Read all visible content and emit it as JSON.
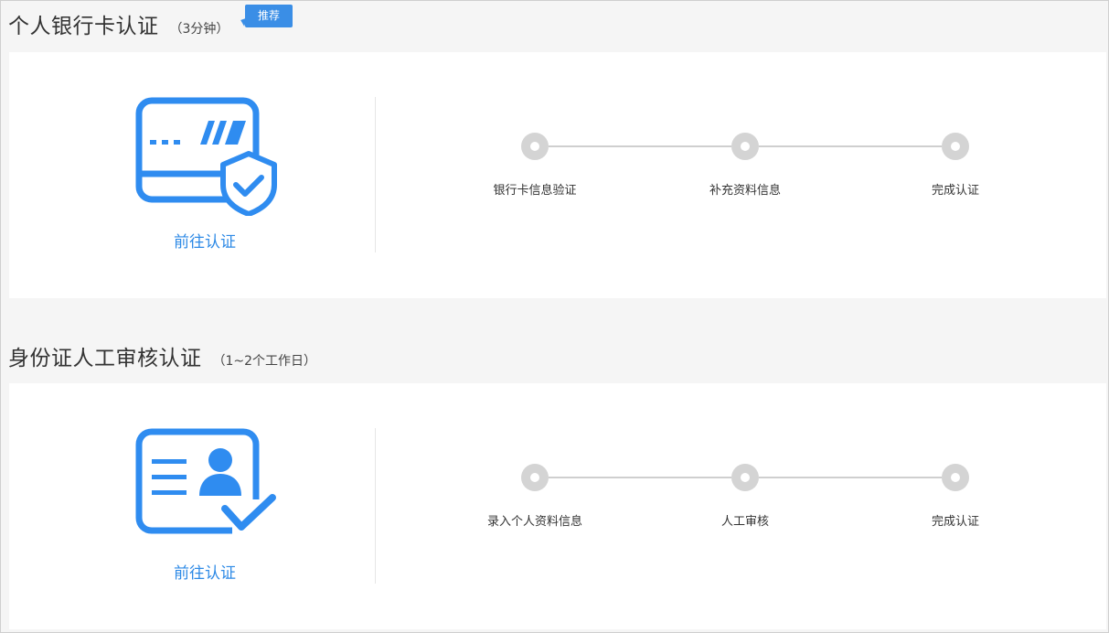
{
  "sections": [
    {
      "title": "个人银行卡认证",
      "subtitle": "（3分钟）",
      "badge": "推荐",
      "icon": "bank-card-shield-icon",
      "link": "前往认证",
      "steps": [
        "银行卡信息验证",
        "补充资料信息",
        "完成认证"
      ]
    },
    {
      "title": "身份证人工审核认证",
      "subtitle": "（1~2个工作日）",
      "icon": "id-card-check-icon",
      "link": "前往认证",
      "steps": [
        "录入个人资料信息",
        "人工审核",
        "完成认证"
      ]
    }
  ],
  "colors": {
    "accent": "#3a8ee6",
    "step_dot": "#d4d4d4",
    "page_bg": "#f5f5f5"
  }
}
